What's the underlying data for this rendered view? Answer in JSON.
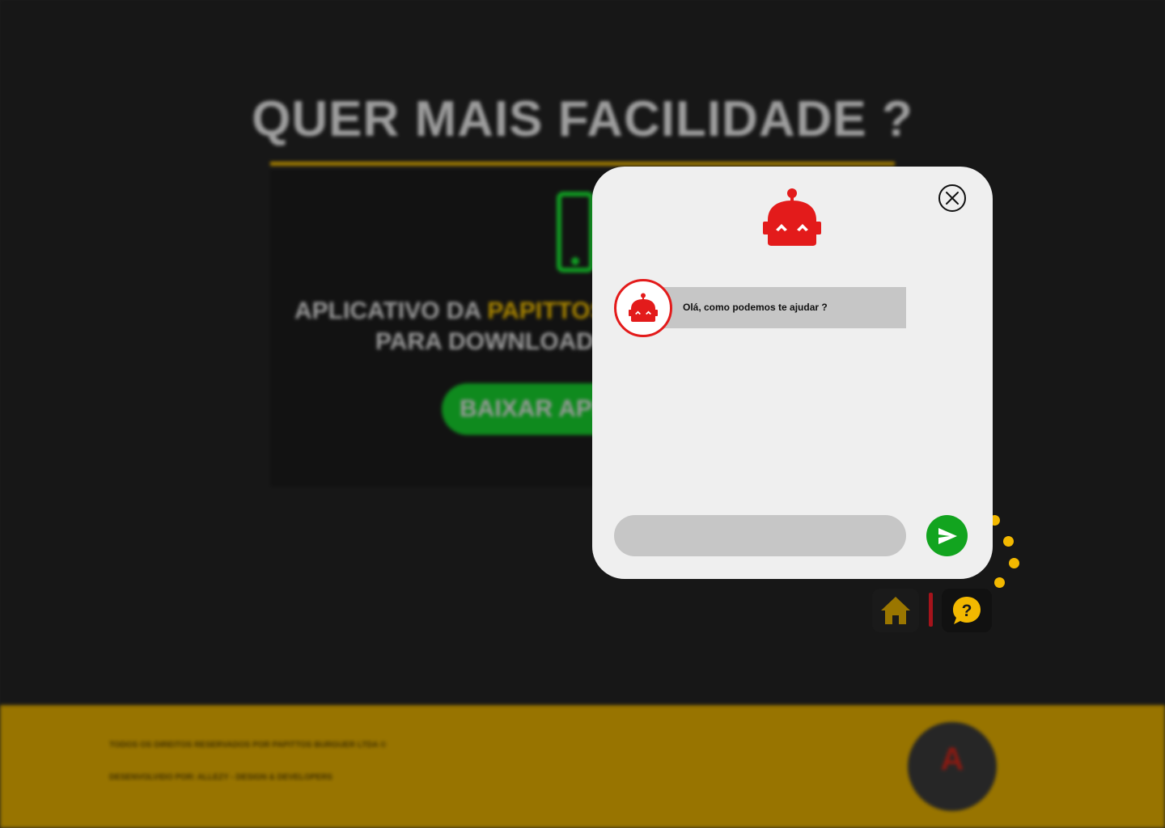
{
  "background": {
    "hero_title": "QUER MAIS FACILIDADE ?",
    "app_text_prefix": "APLICATIVO DA ",
    "app_text_brand": "PAPITTOS",
    "app_text_line2": "PARA DOWNLOAD",
    "download_button": "BAIXAR APP",
    "footer_rights": "TODOS OS DIREITOS RESERVADOS POR PAPITTOS BURGUER LTDA ©",
    "footer_dev": "DESENVOLVIDO POR: ALLEZY - DESIGN & DEVELOPERS",
    "footer_logo_glyph": "A"
  },
  "chat": {
    "greeting": "Olá, como podemos te ajudar ?",
    "input_placeholder": "",
    "close_icon": "close-icon",
    "send_icon": "send-icon",
    "bot_icon": "robot-icon"
  },
  "dock": {
    "home_icon": "home-icon",
    "help_icon": "help-chat-icon",
    "help_glyph": "?"
  },
  "colors": {
    "accent_yellow": "#f2b800",
    "bot_red": "#e31b1b",
    "send_green": "#12a41f",
    "footer_gold": "#987400"
  }
}
